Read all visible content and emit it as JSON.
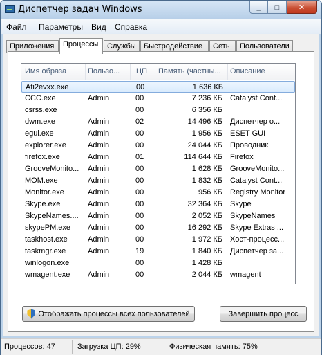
{
  "window": {
    "title": "Диспетчер задач Windows",
    "icon": "task-manager-icon",
    "min": "_",
    "max": "□",
    "close": "✕"
  },
  "menu": [
    "Файл",
    "Параметры",
    "Вид",
    "Справка"
  ],
  "tabs": [
    "Приложения",
    "Процессы",
    "Службы",
    "Быстродействие",
    "Сеть",
    "Пользователи"
  ],
  "active_tab": "Процессы",
  "columns": [
    "Имя образа",
    "Пользо...",
    "ЦП",
    "Память (частны...",
    "Описание"
  ],
  "processes": [
    {
      "name": "Ati2evxx.exe",
      "user": "",
      "cpu": "00",
      "mem": "1 636 КБ",
      "desc": ""
    },
    {
      "name": "CCC.exe",
      "user": "Admin",
      "cpu": "00",
      "mem": "7 236 КБ",
      "desc": "Catalyst Cont..."
    },
    {
      "name": "csrss.exe",
      "user": "",
      "cpu": "00",
      "mem": "6 356 КБ",
      "desc": ""
    },
    {
      "name": "dwm.exe",
      "user": "Admin",
      "cpu": "02",
      "mem": "14 496 КБ",
      "desc": "Диспетчер о..."
    },
    {
      "name": "egui.exe",
      "user": "Admin",
      "cpu": "00",
      "mem": "1 956 КБ",
      "desc": "ESET GUI"
    },
    {
      "name": "explorer.exe",
      "user": "Admin",
      "cpu": "00",
      "mem": "24 044 КБ",
      "desc": "Проводник"
    },
    {
      "name": "firefox.exe",
      "user": "Admin",
      "cpu": "01",
      "mem": "114 644 КБ",
      "desc": "Firefox"
    },
    {
      "name": "GrooveMonito...",
      "user": "Admin",
      "cpu": "00",
      "mem": "1 628 КБ",
      "desc": "GrooveMonito..."
    },
    {
      "name": "MOM.exe",
      "user": "Admin",
      "cpu": "00",
      "mem": "1 832 КБ",
      "desc": "Catalyst Cont..."
    },
    {
      "name": "Monitor.exe",
      "user": "Admin",
      "cpu": "00",
      "mem": "956 КБ",
      "desc": "Registry Monitor"
    },
    {
      "name": "Skype.exe",
      "user": "Admin",
      "cpu": "00",
      "mem": "32 364 КБ",
      "desc": "Skype"
    },
    {
      "name": "SkypeNames....",
      "user": "Admin",
      "cpu": "00",
      "mem": "2 052 КБ",
      "desc": "SkypeNames"
    },
    {
      "name": "skypePM.exe",
      "user": "Admin",
      "cpu": "00",
      "mem": "16 292 КБ",
      "desc": "Skype Extras ..."
    },
    {
      "name": "taskhost.exe",
      "user": "Admin",
      "cpu": "00",
      "mem": "1 972 КБ",
      "desc": "Хост-процесс..."
    },
    {
      "name": "taskmgr.exe",
      "user": "Admin",
      "cpu": "19",
      "mem": "1 840 КБ",
      "desc": "Диспетчер за..."
    },
    {
      "name": "winlogon.exe",
      "user": "",
      "cpu": "00",
      "mem": "1 428 КБ",
      "desc": ""
    },
    {
      "name": "wmagent.exe",
      "user": "Admin",
      "cpu": "00",
      "mem": "2 044 КБ",
      "desc": "wmagent"
    }
  ],
  "buttons": {
    "show_all": "Отображать процессы всех пользователей",
    "end_process": "Завершить процесс"
  },
  "status": {
    "processes": "Процессов: 47",
    "cpu": "Загрузка ЦП: 29%",
    "memory": "Физическая память: 75%"
  }
}
